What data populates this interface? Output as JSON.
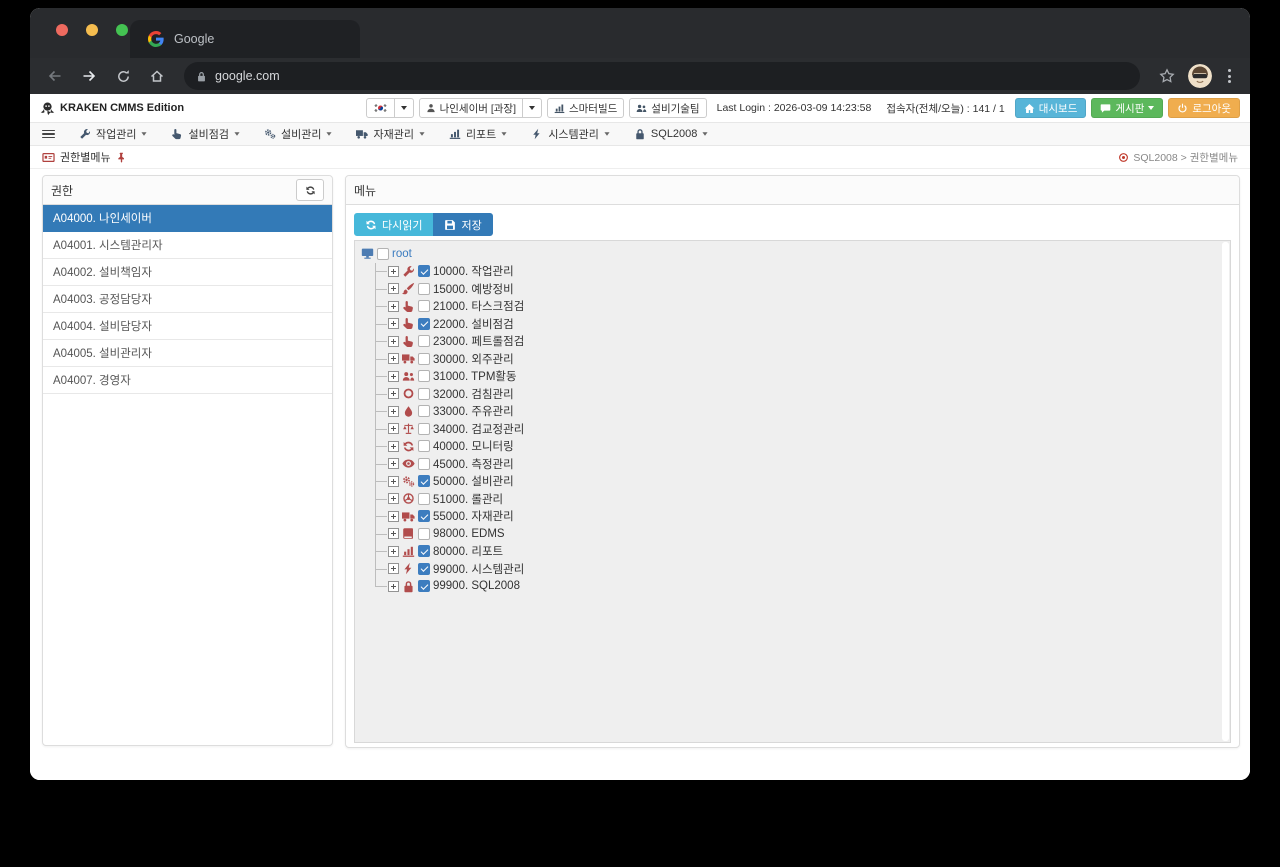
{
  "browser": {
    "tab": {
      "title": "Google",
      "favicon": "google-logo-icon"
    },
    "address": {
      "url": "google.com",
      "lock_icon": "lock-icon"
    },
    "toolbar_icons": [
      "back-icon",
      "forward-icon",
      "reload-icon",
      "home-icon",
      "star-icon",
      "avatar",
      "kebab-menu-icon"
    ]
  },
  "app_header": {
    "brand": "KRAKEN CMMS Edition",
    "logo_icon": "kraken-logo-icon",
    "language": {
      "flag_icon": "korea-flag-icon",
      "caret_icon": "caret-down-icon"
    },
    "user": {
      "icon": "user-icon",
      "label": "나인세이버 [과장]",
      "caret_icon": "caret-down-icon"
    },
    "quick_buttons": [
      {
        "label": "스마터빌드",
        "icon": "bar-chart-icon"
      },
      {
        "label": "설비기술팀",
        "icon": "users-icon"
      }
    ],
    "last_login": "Last Login : 2026-03-09 14:23:58",
    "visitors": "접속자(전체/오늘) : 141 / 1",
    "action_buttons": [
      {
        "label": "대시보드",
        "icon": "home-icon",
        "color": "#58b5d8",
        "caret": false
      },
      {
        "label": "게시판",
        "icon": "chat-icon",
        "color": "#5cb85c",
        "caret": true
      },
      {
        "label": "로그아웃",
        "icon": "power-icon",
        "color": "#f0ad4e",
        "caret": false
      }
    ]
  },
  "nav": {
    "menu_icon": "hamburger-icon",
    "items": [
      {
        "label": "작업관리",
        "icon": "wrench-icon"
      },
      {
        "label": "설비점검",
        "icon": "hand-icon"
      },
      {
        "label": "설비관리",
        "icon": "cogs-icon"
      },
      {
        "label": "자재관리",
        "icon": "truck-icon"
      },
      {
        "label": "리포트",
        "icon": "bar-chart-icon"
      },
      {
        "label": "시스템관리",
        "icon": "bolt-icon"
      },
      {
        "label": "SQL2008",
        "icon": "lock-icon"
      }
    ]
  },
  "breadcrumb": {
    "icon": "id-card-icon",
    "title": "권한별메뉴",
    "pin_icon": "pin-icon",
    "path_icon": "target-icon",
    "path": "SQL2008 > 권한별메뉴"
  },
  "roles_panel": {
    "title": "권한",
    "refresh_icon": "refresh-icon",
    "items": [
      {
        "label": "A04000. 나인세이버",
        "selected": true
      },
      {
        "label": "A04001. 시스템관리자",
        "selected": false
      },
      {
        "label": "A04002. 설비책임자",
        "selected": false
      },
      {
        "label": "A04003. 공정담당자",
        "selected": false
      },
      {
        "label": "A04004. 설비담당자",
        "selected": false
      },
      {
        "label": "A04005. 설비관리자",
        "selected": false
      },
      {
        "label": "A04007. 경영자",
        "selected": false
      }
    ]
  },
  "menu_panel": {
    "title": "메뉴",
    "buttons": [
      {
        "label": "다시읽기",
        "icon": "refresh-icon",
        "color": "#46b8da"
      },
      {
        "label": "저장",
        "icon": "save-icon",
        "color": "#337ab7"
      }
    ],
    "tree": {
      "root": {
        "label": "root",
        "icon": "monitor-icon",
        "checked": false
      },
      "nodes": [
        {
          "label": "10000. 작업관리",
          "icon": "wrench-icon",
          "checked": true
        },
        {
          "label": "15000. 예방정비",
          "icon": "brush-icon",
          "checked": false
        },
        {
          "label": "21000. 타스크점검",
          "icon": "hand-icon",
          "checked": false
        },
        {
          "label": "22000. 설비점검",
          "icon": "hand-icon",
          "checked": true
        },
        {
          "label": "23000. 페트롤점검",
          "icon": "hand-icon",
          "checked": false
        },
        {
          "label": "30000. 외주관리",
          "icon": "truck-icon",
          "checked": false
        },
        {
          "label": "31000. TPM활동",
          "icon": "users-icon",
          "checked": false
        },
        {
          "label": "32000. 검침관리",
          "icon": "circle-icon",
          "checked": false
        },
        {
          "label": "33000. 주유관리",
          "icon": "droplet-icon",
          "checked": false
        },
        {
          "label": "34000. 검교정관리",
          "icon": "balance-icon",
          "checked": false
        },
        {
          "label": "40000. 모니터링",
          "icon": "refresh-icon",
          "checked": false
        },
        {
          "label": "45000. 측정관리",
          "icon": "eye-icon",
          "checked": false
        },
        {
          "label": "50000. 설비관리",
          "icon": "cogs-icon",
          "checked": true
        },
        {
          "label": "51000. 롤관리",
          "icon": "steering-wheel-icon",
          "checked": false
        },
        {
          "label": "55000. 자재관리",
          "icon": "truck-icon",
          "checked": true
        },
        {
          "label": "98000. EDMS",
          "icon": "book-icon",
          "checked": false
        },
        {
          "label": "80000. 리포트",
          "icon": "bar-chart-icon",
          "checked": true
        },
        {
          "label": "99000. 시스템관리",
          "icon": "bolt-icon",
          "checked": true
        },
        {
          "label": "99900. SQL2008",
          "icon": "lock-icon",
          "checked": true
        }
      ]
    }
  },
  "colors": {
    "accent_blue": "#337ab7",
    "info_blue": "#58b5d8",
    "success_green": "#5cb85c",
    "warning_orange": "#f0ad4e",
    "tree_icon_red": "#b14c4c",
    "checkbox_blue": "#3d7dbf"
  }
}
